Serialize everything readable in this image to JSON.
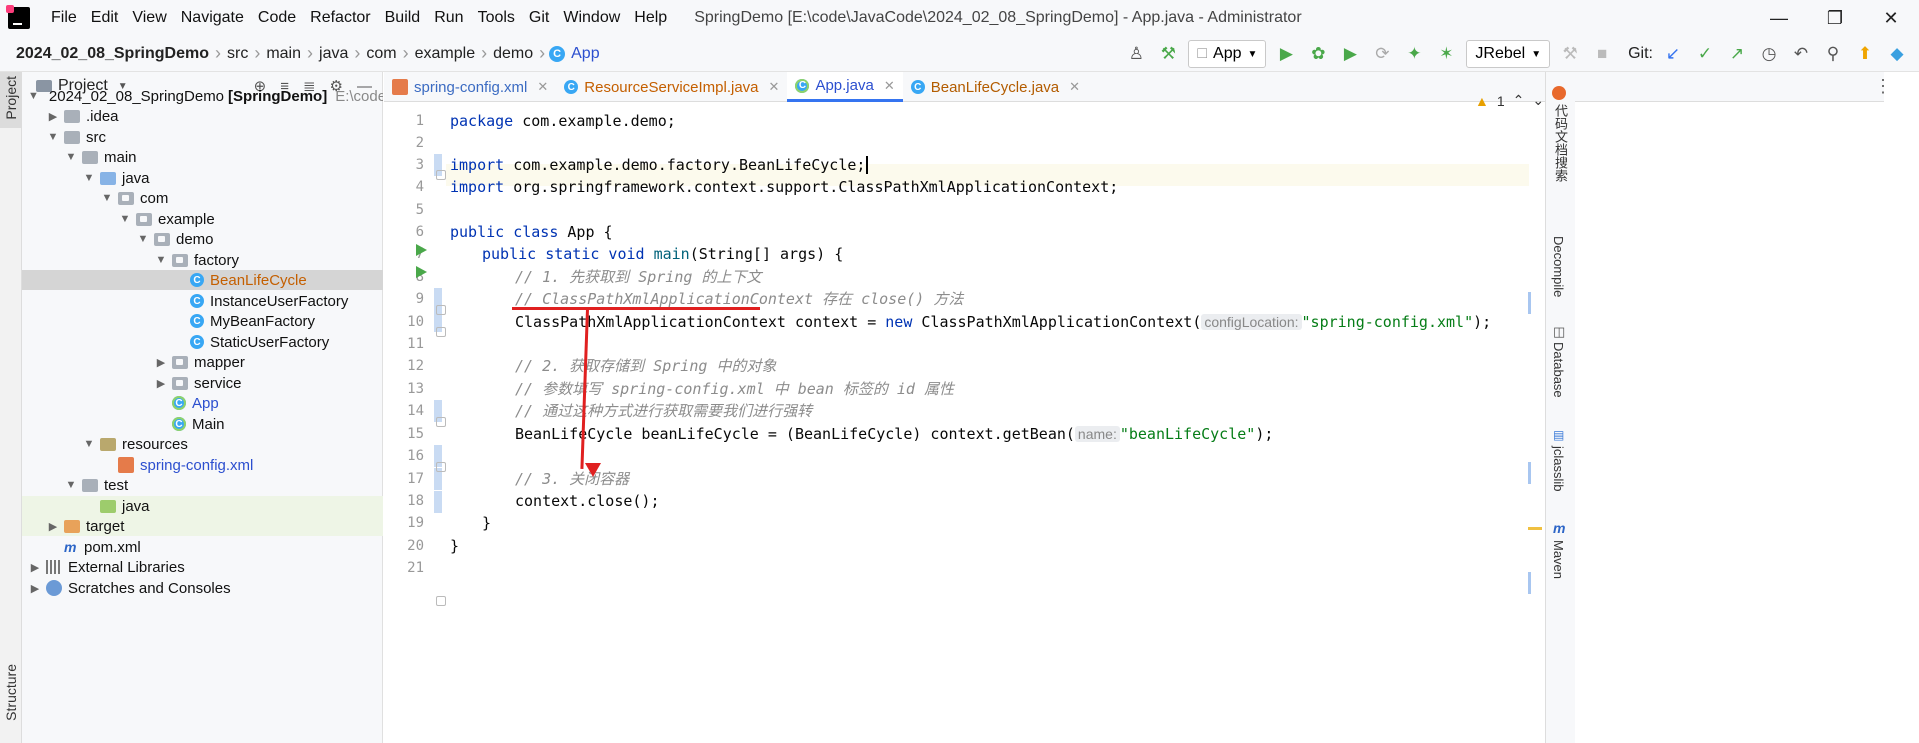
{
  "titlebar": {
    "menus": [
      "File",
      "Edit",
      "View",
      "Navigate",
      "Code",
      "Refactor",
      "Build",
      "Run",
      "Tools",
      "Git",
      "Window",
      "Help"
    ],
    "window_title": "SpringDemo [E:\\code\\JavaCode\\2024_02_08_SpringDemo] - App.java - Administrator"
  },
  "navbar": {
    "crumbs": [
      "2024_02_08_SpringDemo",
      "src",
      "main",
      "java",
      "com",
      "example",
      "demo",
      "App"
    ],
    "run_config": "App",
    "jrebel": "JRebel",
    "git_label": "Git:"
  },
  "left_stripe": {
    "project": "Project",
    "structure": "Structure"
  },
  "project": {
    "title": "Project",
    "tree": [
      {
        "label": "2024_02_08_SpringDemo",
        "suffix": "[SpringDemo]",
        "path": "E:\\code\\Jav"
      },
      {
        "label": ".idea"
      },
      {
        "label": "src"
      },
      {
        "label": "main"
      },
      {
        "label": "java"
      },
      {
        "label": "com"
      },
      {
        "label": "example"
      },
      {
        "label": "demo"
      },
      {
        "label": "factory"
      },
      {
        "label": "BeanLifeCycle"
      },
      {
        "label": "InstanceUserFactory"
      },
      {
        "label": "MyBeanFactory"
      },
      {
        "label": "StaticUserFactory"
      },
      {
        "label": "mapper"
      },
      {
        "label": "service"
      },
      {
        "label": "App"
      },
      {
        "label": "Main"
      },
      {
        "label": "resources"
      },
      {
        "label": "spring-config.xml"
      },
      {
        "label": "test"
      },
      {
        "label": "java"
      },
      {
        "label": "target"
      },
      {
        "label": "pom.xml"
      },
      {
        "label": "External Libraries"
      },
      {
        "label": "Scratches and Consoles"
      }
    ]
  },
  "tabs": [
    {
      "label": "spring-config.xml"
    },
    {
      "label": "ResourceServiceImpl.java"
    },
    {
      "label": "App.java"
    },
    {
      "label": "BeanLifeCycle.java"
    }
  ],
  "editor": {
    "warning_count": "1",
    "line_numbers": [
      "1",
      "2",
      "3",
      "4",
      "5",
      "6",
      "7",
      "8",
      "9",
      "10",
      "11",
      "12",
      "13",
      "14",
      "15",
      "16",
      "17",
      "18",
      "19",
      "20",
      "21"
    ],
    "lines": {
      "l1_kw": "package",
      "l1_rest": " com.example.demo;",
      "l3_kw": "import",
      "l3_rest": " com.example.demo.factory.BeanLifeCycle;",
      "l4_kw": "import",
      "l4_rest": " org.springframework.context.support.ClassPathXmlApplicationContext;",
      "l6_kw": "public class",
      "l6_rest": " App {",
      "l7_kw": "public static void",
      "l7_fn": "main",
      "l7_rest": "(String[] args) {",
      "l8": "// 1. 先获取到 Spring 的上下文",
      "l9": "// ClassPathXmlApplicationContext 存在 close() 方法",
      "l10_a": "ClassPathXmlApplicationContext context = ",
      "l10_kw": "new",
      "l10_b": " ClassPathXmlApplicationContext(",
      "l10_hint": "configLocation:",
      "l10_str": "\"spring-config.xml\"",
      "l10_end": ");",
      "l12": "// 2. 获取存储到 Spring 中的对象",
      "l13": "// 参数填写 spring-config.xml 中 bean 标签的 id 属性",
      "l14": "// 通过这种方式进行获取需要我们进行强转",
      "l15_a": "BeanLifeCycle beanLifeCycle = (BeanLifeCycle) context.getBean(",
      "l15_hint": "name:",
      "l15_str": "\"beanLifeCycle\"",
      "l15_end": ");",
      "l17": "// 3. 关闭容器",
      "l18": "context.close();",
      "l19": "}",
      "l20": "}"
    }
  },
  "right_stripe": [
    "代码文档搜索",
    "Decompile",
    "Database",
    "jclasslib",
    "Maven"
  ]
}
